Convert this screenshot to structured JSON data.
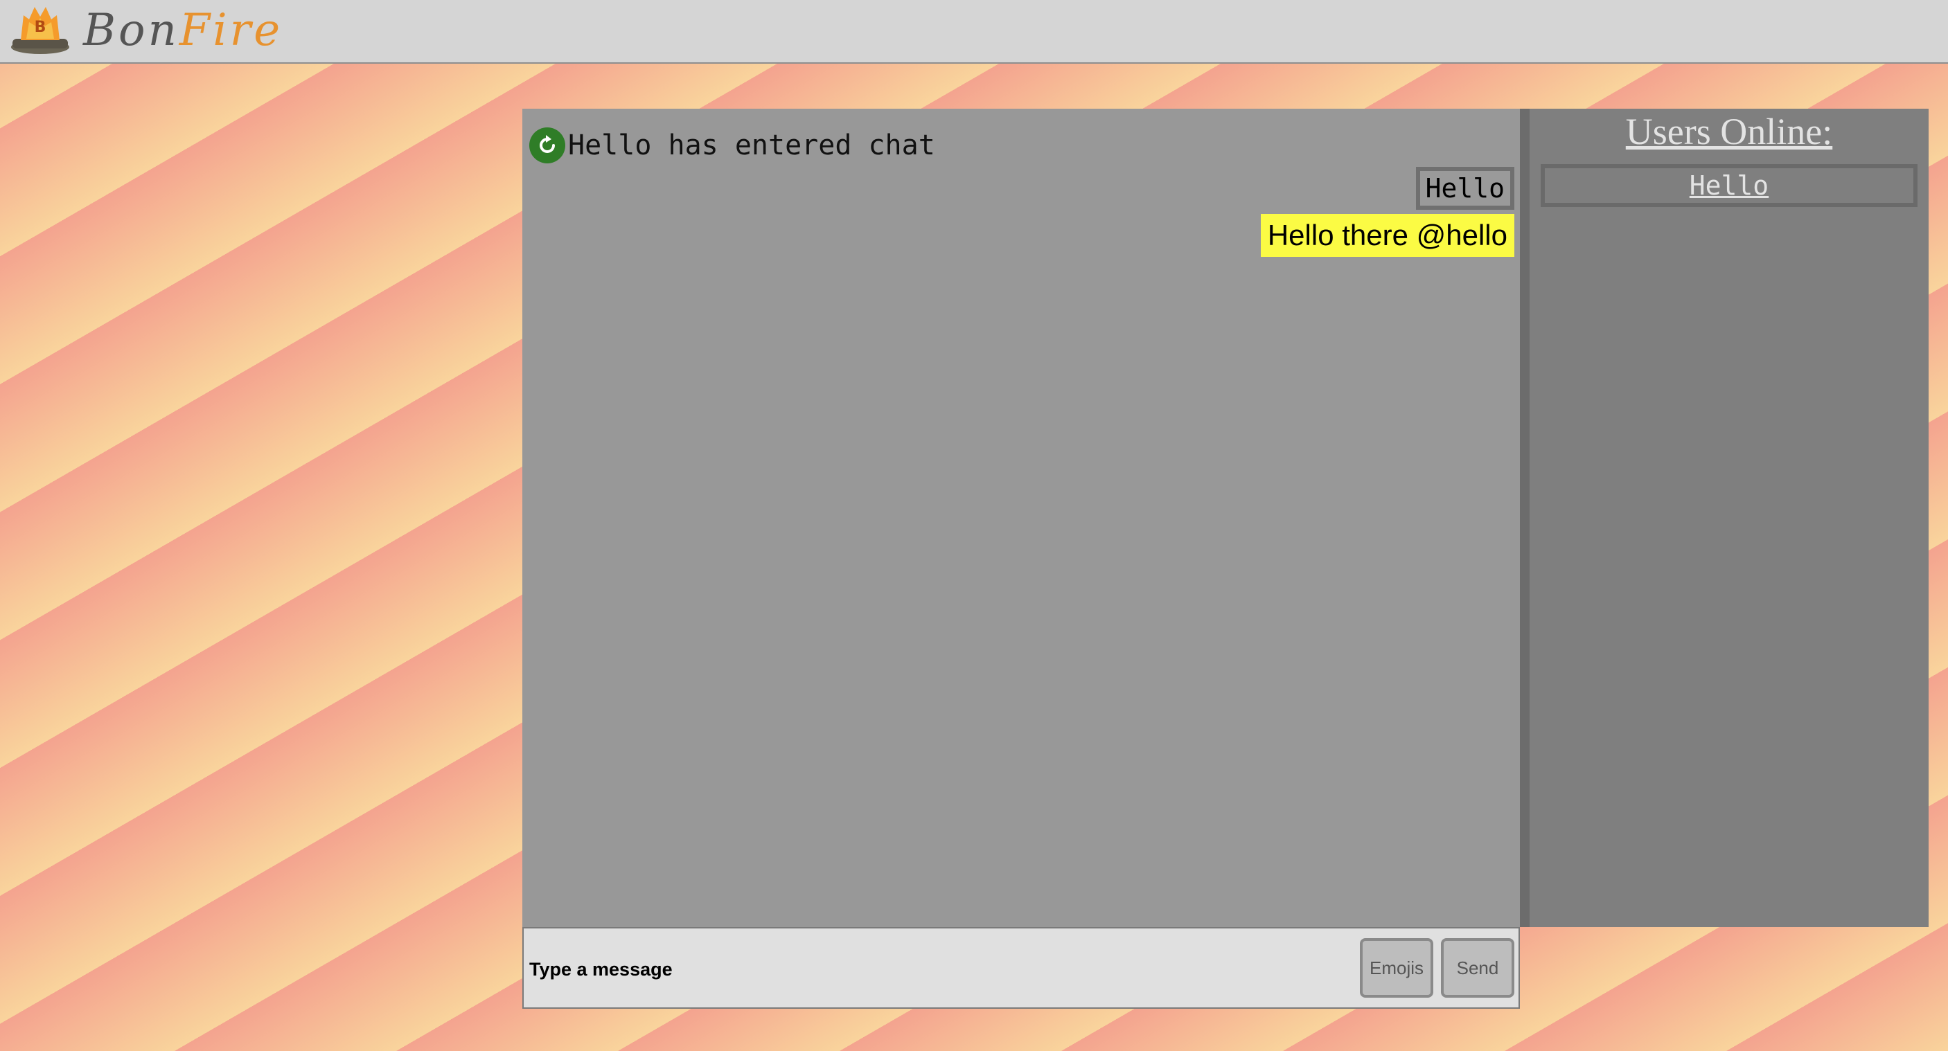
{
  "app": {
    "logo_badge": "B",
    "logo_text_part1": "Bon",
    "logo_text_part2": "Fire"
  },
  "chat": {
    "join_message": "Hello has entered chat",
    "join_icon": "refresh-icon",
    "message": {
      "sender": "Hello",
      "text": "Hello there @hello",
      "highlight_color": "#fbfb44"
    }
  },
  "users": {
    "title": "Users Online:",
    "list": [
      "Hello"
    ]
  },
  "composer": {
    "placeholder": "Type a message",
    "emoji_label": "Emojis",
    "send_label": "Send"
  },
  "colors": {
    "header_bg": "#d5d5d5",
    "chat_bg": "#989898",
    "users_bg": "#7f7f7f",
    "join_icon_bg": "#2f7d27"
  }
}
